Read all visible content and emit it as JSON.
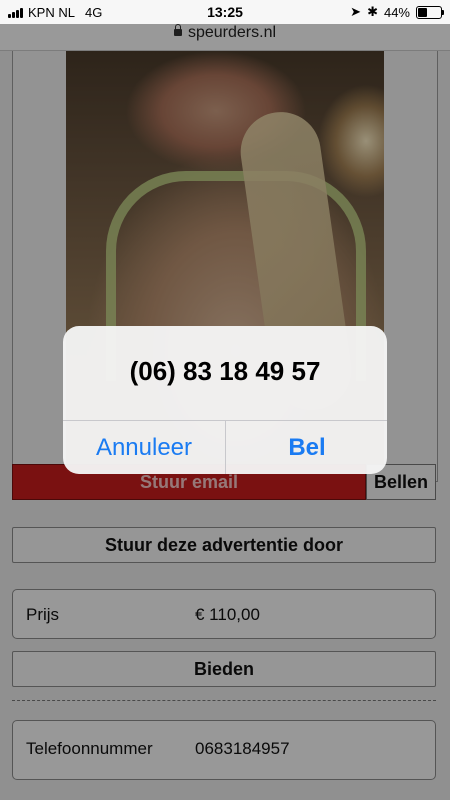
{
  "status_bar": {
    "carrier": "KPN NL",
    "network": "4G",
    "time": "13:25",
    "battery_percent": "44%",
    "battery_level": 0.44
  },
  "browser": {
    "url": "speurders.nl"
  },
  "alert": {
    "message": "(06) 83 18 49 57",
    "cancel_label": "Annuleer",
    "call_label": "Bel"
  },
  "actions": {
    "email_label": "Stuur email",
    "call_label": "Bellen",
    "forward_label": "Stuur deze advertentie door",
    "bid_label": "Bieden"
  },
  "details": {
    "price_label": "Prijs",
    "price_value": "€ 110,00",
    "phone_label": "Telefoonnummer",
    "phone_value": "0683184957"
  },
  "colors": {
    "email_button": "#c61c1c",
    "ios_blue": "#1a7bf2"
  }
}
